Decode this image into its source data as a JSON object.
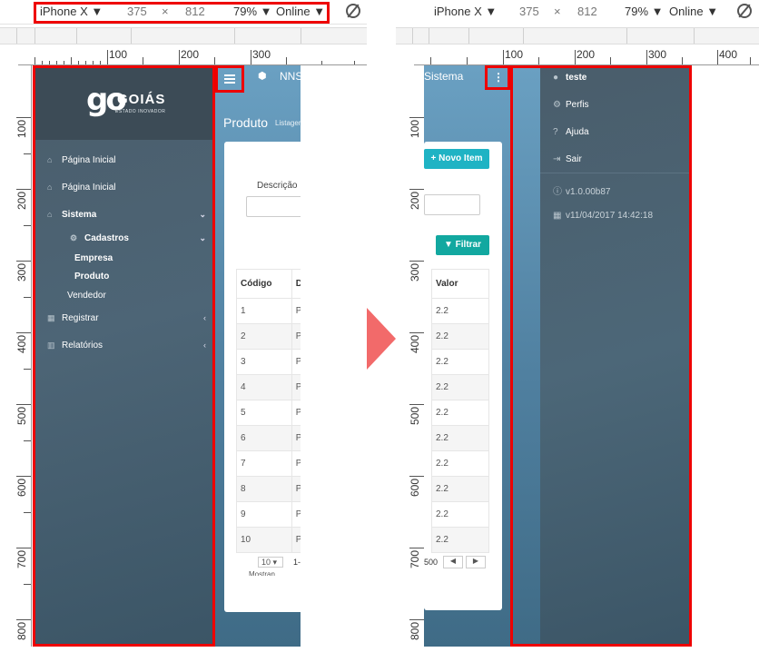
{
  "devtools": {
    "device": "iPhone X",
    "width": "375",
    "times": "×",
    "height": "812",
    "zoom": "79%",
    "network": "Online"
  },
  "ruler": {
    "h_left": [
      "100",
      "200",
      "300"
    ],
    "h_right": [
      "100",
      "200",
      "300",
      "400"
    ],
    "v_left": [
      "100",
      "200",
      "300",
      "400",
      "500",
      "600",
      "700",
      "800"
    ],
    "v_right": [
      "100",
      "200",
      "300",
      "400",
      "500",
      "600",
      "700",
      "800"
    ]
  },
  "left_app": {
    "logo_mark": "go",
    "logo_word": "GOIÁS",
    "logo_tagline": "ESTADO INOVADOR",
    "brand": "NNS",
    "page_title": "Produto",
    "page_subtitle": "Listagem",
    "description_label": "Descrição",
    "menu": {
      "home1": "Página Inicial",
      "home2": "Página Inicial",
      "sistema": "Sistema",
      "cadastros": "Cadastros",
      "empresa": "Empresa",
      "produto": "Produto",
      "vendedor": "Vendedor",
      "registrar": "Registrar",
      "relatorios": "Relatórios"
    },
    "table_headers": [
      "Código",
      "Des"
    ],
    "rows": [
      [
        "1",
        "Pro"
      ],
      [
        "2",
        "Pro"
      ],
      [
        "3",
        "Pro"
      ],
      [
        "4",
        "Pro"
      ],
      [
        "5",
        "Pro"
      ],
      [
        "6",
        "Pro"
      ],
      [
        "7",
        "Pro"
      ],
      [
        "8",
        "Pro"
      ],
      [
        "9",
        "Pro"
      ],
      [
        "10",
        "Pro"
      ]
    ],
    "page_size": "10",
    "range": "1-",
    "showing": "Mostran"
  },
  "right_app": {
    "header_text": "Sistema",
    "new_item": "+ Novo Item",
    "filter": "Filtrar",
    "value_header": "Valor",
    "values": [
      "2.2",
      "2.2",
      "2.2",
      "2.2",
      "2.2",
      "2.2",
      "2.2",
      "2.2",
      "2.2",
      "2.2"
    ],
    "footer_count": "500",
    "menu": {
      "user": "teste",
      "profiles": "Perfis",
      "help": "Ajuda",
      "logout": "Sair",
      "version": "v1.0.00b87",
      "datetime": "v11/04/2017 14:42:18"
    }
  },
  "colors": {
    "highlight": "#e00000",
    "arrow": "#f26a6a",
    "button_teal": "#1fb3c4",
    "filter_teal": "#12a8a0"
  }
}
